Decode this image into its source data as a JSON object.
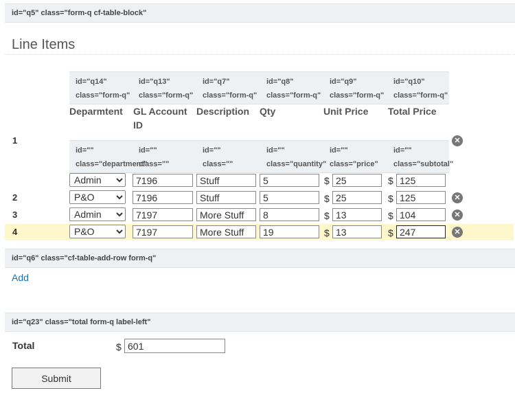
{
  "block1": {
    "id_label": "id=\"q5\"",
    "class_label": "class=\"form-q cf-table-block\""
  },
  "section_title": "Line Items",
  "columns": [
    {
      "id_label": "id=\"q14\"",
      "class_label": "class=\"form-q\"",
      "header": "Deparmtent"
    },
    {
      "id_label": "id=\"q13\"",
      "class_label": "class=\"form-q\"",
      "header_line1": "GL Account",
      "header_line2": "ID"
    },
    {
      "id_label": "id=\"q7\"",
      "class_label": "class=\"form-q\"",
      "header": "Description"
    },
    {
      "id_label": "id=\"q8\"",
      "class_label": "class=\"form-q\"",
      "header": "Qty"
    },
    {
      "id_label": "id=\"q9\"",
      "class_label": "class=\"form-q\"",
      "header": "Unit Price"
    },
    {
      "id_label": "id=\"q10\"",
      "class_label": "class=\"form-q\"",
      "header": "Total Price"
    }
  ],
  "subcols": [
    {
      "id_label": "id=\"\"",
      "class_label": "class=\"department\""
    },
    {
      "id_label": "id=\"\"",
      "class_label": "class=\"\""
    },
    {
      "id_label": "id=\"\"",
      "class_label": "class=\"\""
    },
    {
      "id_label": "id=\"\"",
      "class_label": "class=\"quantity\""
    },
    {
      "id_label": "id=\"\"",
      "class_label": "class=\"price\""
    },
    {
      "id_label": "id=\"\"",
      "class_label": "class=\"subtotal\""
    }
  ],
  "currency": "$",
  "remove_icon": "close-circle-icon",
  "rows": [
    {
      "num": "1",
      "department": "Admin",
      "gl": "7196",
      "desc": "Stuff",
      "qty": "5",
      "price": "25",
      "total": "125"
    },
    {
      "num": "2",
      "department": "P&O",
      "gl": "7196",
      "desc": "Stuff",
      "qty": "5",
      "price": "25",
      "total": "125"
    },
    {
      "num": "3",
      "department": "Admin",
      "gl": "7197",
      "desc": "More Stuff",
      "qty": "8",
      "price": "13",
      "total": "104"
    },
    {
      "num": "4",
      "department": "P&O",
      "gl": "7197",
      "desc": "More Stuff",
      "qty": "19",
      "price": "13",
      "total": "247"
    }
  ],
  "block2": {
    "id_label": "id=\"q6\"",
    "class_label": "class=\"cf-table-add-row form-q\""
  },
  "add_label": "Add",
  "block3": {
    "id_label": "id=\"q23\"",
    "class_label": "class=\"total form-q label-left\""
  },
  "total": {
    "label": "Total",
    "value": "601"
  },
  "submit_label": "Submit",
  "highlight_color": "#fff7cc"
}
